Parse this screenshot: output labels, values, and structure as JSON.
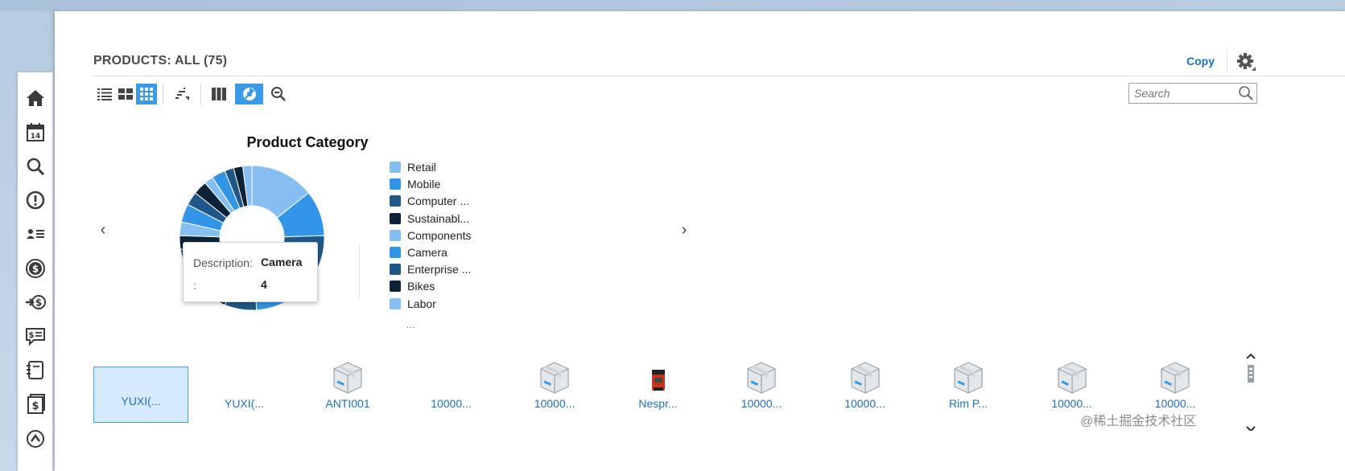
{
  "page": {
    "title": "PRODUCTS: ALL (75)",
    "copy_label": "Copy",
    "search_placeholder": "Search",
    "watermark": "@稀土掘金技术社区"
  },
  "sidebar": {
    "items": [
      {
        "icon": "home-icon"
      },
      {
        "icon": "calendar-icon",
        "day": "14"
      },
      {
        "icon": "search-icon"
      },
      {
        "icon": "alert-icon"
      },
      {
        "icon": "contacts-list-icon"
      },
      {
        "icon": "dollar-circle-icon"
      },
      {
        "icon": "transfer-dollar-icon"
      },
      {
        "icon": "price-chat-icon"
      },
      {
        "icon": "notebook-icon"
      },
      {
        "icon": "invoice-dollar-icon"
      },
      {
        "icon": "arrow-circle-icon"
      }
    ]
  },
  "toolbar": {
    "buttons": [
      {
        "icon": "list-view-icon",
        "active": false
      },
      {
        "icon": "table-view-icon",
        "active": false
      },
      {
        "icon": "grid-view-icon",
        "active": true
      },
      {
        "icon": "sort-icon",
        "active": false
      },
      {
        "icon": "columns-icon",
        "active": false
      },
      {
        "icon": "chart-view-icon",
        "active": true
      },
      {
        "icon": "zoom-filter-icon",
        "active": false
      }
    ]
  },
  "colors": {
    "accent": "#3b9ae6",
    "link": "#1f6fbf",
    "selected_bg": "#d6ebfb"
  },
  "chart_data": {
    "type": "pie",
    "title": "Product Category",
    "legend_position": "right",
    "legend": [
      {
        "label": "Retail",
        "color": "#85bff2"
      },
      {
        "label": "Mobile",
        "color": "#3395e6"
      },
      {
        "label": "Computer ...",
        "color": "#1f5888"
      },
      {
        "label": "Sustainabl...",
        "color": "#0d2236"
      },
      {
        "label": "Components",
        "color": "#85bff2"
      },
      {
        "label": "Camera",
        "color": "#3395e6"
      },
      {
        "label": "Enterprise ...",
        "color": "#1f5888"
      },
      {
        "label": "Bikes",
        "color": "#0d2236"
      },
      {
        "label": "Labor",
        "color": "#85bff2"
      }
    ],
    "legend_more": "...",
    "tooltip": {
      "description_label": "Description:",
      "description_value": "Camera",
      "count_label": ":",
      "count_value": "4"
    }
  },
  "cards": [
    {
      "label": "YUXI(...",
      "thumb": "none",
      "selected": true
    },
    {
      "label": "YUXI(...",
      "thumb": "none",
      "selected": false
    },
    {
      "label": "ANTI001",
      "thumb": "box",
      "selected": false
    },
    {
      "label": "10000...",
      "thumb": "none",
      "selected": false
    },
    {
      "label": "10000...",
      "thumb": "box",
      "selected": false
    },
    {
      "label": "Nespr...",
      "thumb": "coffee",
      "selected": false
    },
    {
      "label": "10000...",
      "thumb": "box",
      "selected": false
    },
    {
      "label": "10000...",
      "thumb": "box",
      "selected": false
    },
    {
      "label": "Rim P...",
      "thumb": "box",
      "selected": false
    },
    {
      "label": "10000...",
      "thumb": "box",
      "selected": false
    },
    {
      "label": "10000...",
      "thumb": "box",
      "selected": false
    }
  ]
}
